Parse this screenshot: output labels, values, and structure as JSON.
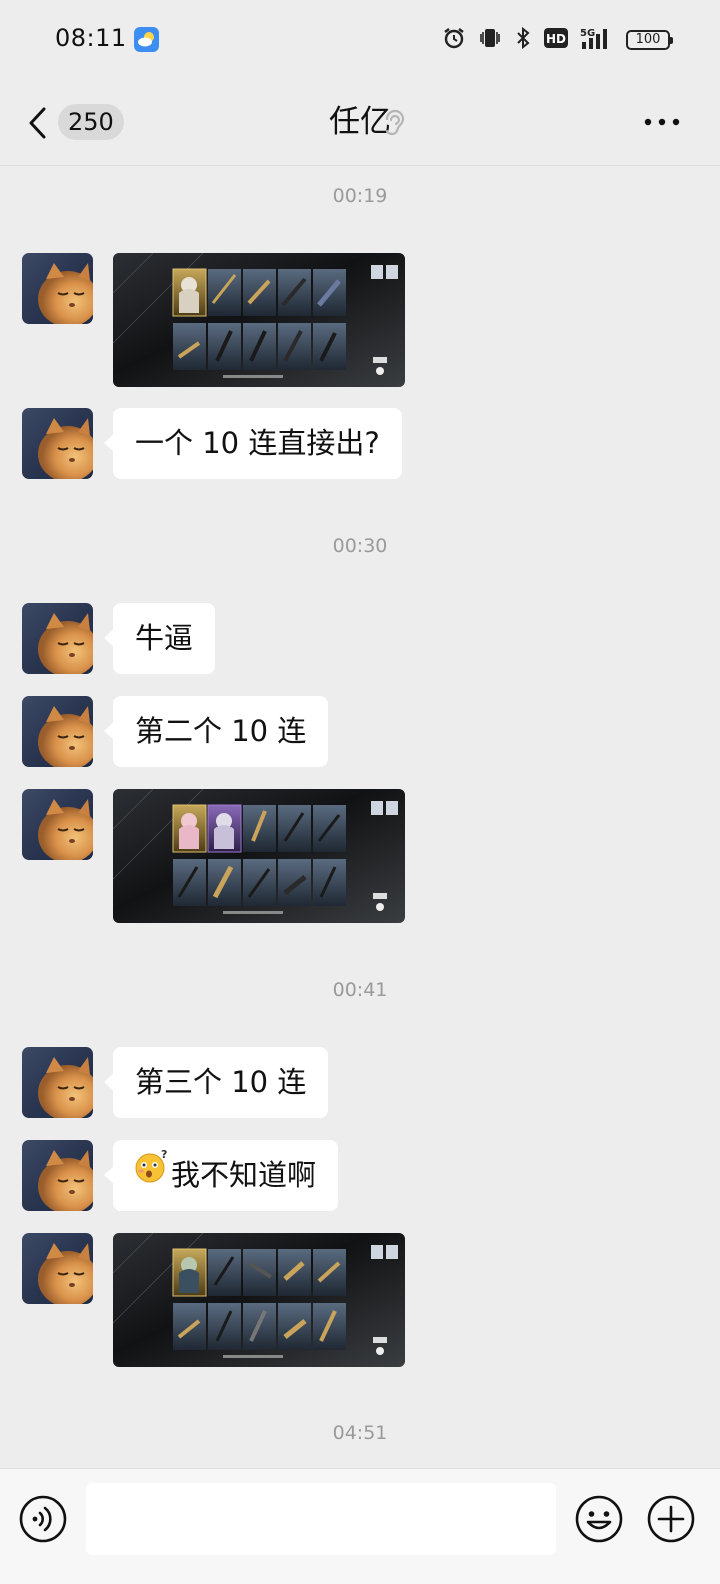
{
  "status_bar": {
    "time": "08:11",
    "network": "5G",
    "hd_label": "HD",
    "battery": "100"
  },
  "header": {
    "unread_count": "250",
    "title": "任亿"
  },
  "messages": [
    {
      "type": "timestamp",
      "text": "00:19"
    },
    {
      "type": "image",
      "alt": "game gacha result screenshot"
    },
    {
      "type": "text",
      "text": "一个 10 连直接出?"
    },
    {
      "type": "timestamp",
      "text": "00:30"
    },
    {
      "type": "text",
      "text": "牛逼"
    },
    {
      "type": "text",
      "text": "第二个 10 连"
    },
    {
      "type": "image",
      "alt": "game gacha result screenshot"
    },
    {
      "type": "timestamp",
      "text": "00:41"
    },
    {
      "type": "text",
      "text": "第三个 10 连"
    },
    {
      "type": "text",
      "emoji": "😳",
      "text": "我不知道啊"
    },
    {
      "type": "image",
      "alt": "game gacha result screenshot"
    },
    {
      "type": "timestamp",
      "text": "04:51"
    }
  ],
  "input_bar": {
    "placeholder": "",
    "value": ""
  },
  "colors": {
    "background": "#ededed",
    "bubble": "#ffffff",
    "timestamp": "#9a9a9a",
    "input_bar": "#f7f7f7"
  }
}
